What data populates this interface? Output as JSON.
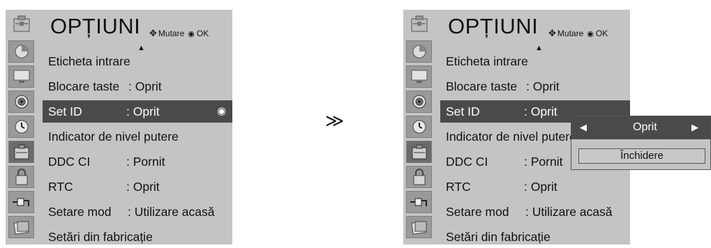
{
  "left": {
    "title": "OPȚIUNI",
    "hint_move": "Mutare",
    "hint_ok": "OK",
    "items": [
      {
        "label": "Eticheta intrare",
        "value": ""
      },
      {
        "label": "Blocare taste",
        "value": ": Oprit"
      },
      {
        "label": "Set ID",
        "value": ": Oprit"
      },
      {
        "label": "Indicator de nivel putere",
        "value": ""
      },
      {
        "label": "DDC CI",
        "value": ": Pornit"
      },
      {
        "label": "RTC",
        "value": ": Oprit"
      },
      {
        "label": "Setare mod",
        "value": ": Utilizare acasă"
      },
      {
        "label": "Setări din fabricație",
        "value": ""
      }
    ],
    "selected_index": 2
  },
  "between_symbol": "≫",
  "right": {
    "title": "OPȚIUNI",
    "hint_move": "Mutare",
    "hint_ok": "OK",
    "items": [
      {
        "label": "Eticheta intrare",
        "value": ""
      },
      {
        "label": "Blocare taste",
        "value": ": Oprit"
      },
      {
        "label": "Set ID",
        "value": ": Oprit"
      },
      {
        "label": "Indicator de nivel putere",
        "value": ""
      },
      {
        "label": "DDC CI",
        "value": ": Pornit"
      },
      {
        "label": "RTC",
        "value": ": Oprit"
      },
      {
        "label": "Setare mod",
        "value": ": Utilizare acasă"
      },
      {
        "label": "Setări din fabricație",
        "value": ""
      }
    ],
    "selected_index": 2
  },
  "popup": {
    "value": "Oprit",
    "close_label": "Închidere"
  },
  "icons": [
    "options-header-icon",
    "picture-icon",
    "screen-icon",
    "audio-icon",
    "time-icon",
    "options-icon",
    "lock-icon",
    "input-icon",
    "photo-icon"
  ],
  "colors": {
    "panel": "#c4c4c4",
    "selected": "#4a4a4a",
    "icon_bg": "#9a9a9a"
  }
}
